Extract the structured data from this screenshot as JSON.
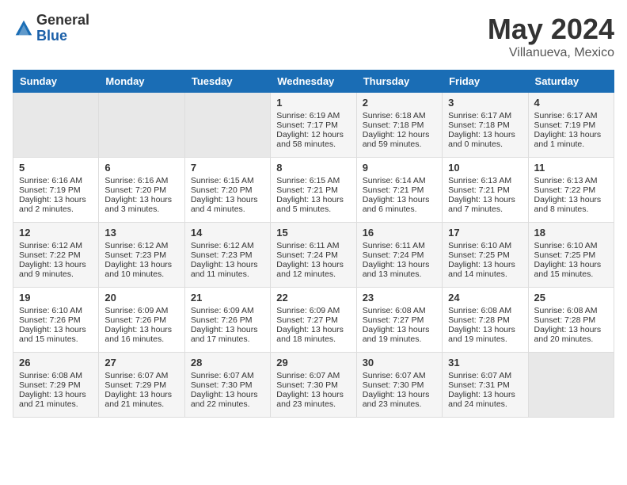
{
  "header": {
    "logo_general": "General",
    "logo_blue": "Blue",
    "month_year": "May 2024",
    "location": "Villanueva, Mexico"
  },
  "days_of_week": [
    "Sunday",
    "Monday",
    "Tuesday",
    "Wednesday",
    "Thursday",
    "Friday",
    "Saturday"
  ],
  "weeks": [
    [
      {
        "day": "",
        "sunrise": "",
        "sunset": "",
        "daylight": "",
        "empty": true
      },
      {
        "day": "",
        "sunrise": "",
        "sunset": "",
        "daylight": "",
        "empty": true
      },
      {
        "day": "",
        "sunrise": "",
        "sunset": "",
        "daylight": "",
        "empty": true
      },
      {
        "day": "1",
        "sunrise": "Sunrise: 6:19 AM",
        "sunset": "Sunset: 7:17 PM",
        "daylight": "Daylight: 12 hours and 58 minutes."
      },
      {
        "day": "2",
        "sunrise": "Sunrise: 6:18 AM",
        "sunset": "Sunset: 7:18 PM",
        "daylight": "Daylight: 12 hours and 59 minutes."
      },
      {
        "day": "3",
        "sunrise": "Sunrise: 6:17 AM",
        "sunset": "Sunset: 7:18 PM",
        "daylight": "Daylight: 13 hours and 0 minutes."
      },
      {
        "day": "4",
        "sunrise": "Sunrise: 6:17 AM",
        "sunset": "Sunset: 7:19 PM",
        "daylight": "Daylight: 13 hours and 1 minute."
      }
    ],
    [
      {
        "day": "5",
        "sunrise": "Sunrise: 6:16 AM",
        "sunset": "Sunset: 7:19 PM",
        "daylight": "Daylight: 13 hours and 2 minutes."
      },
      {
        "day": "6",
        "sunrise": "Sunrise: 6:16 AM",
        "sunset": "Sunset: 7:20 PM",
        "daylight": "Daylight: 13 hours and 3 minutes."
      },
      {
        "day": "7",
        "sunrise": "Sunrise: 6:15 AM",
        "sunset": "Sunset: 7:20 PM",
        "daylight": "Daylight: 13 hours and 4 minutes."
      },
      {
        "day": "8",
        "sunrise": "Sunrise: 6:15 AM",
        "sunset": "Sunset: 7:21 PM",
        "daylight": "Daylight: 13 hours and 5 minutes."
      },
      {
        "day": "9",
        "sunrise": "Sunrise: 6:14 AM",
        "sunset": "Sunset: 7:21 PM",
        "daylight": "Daylight: 13 hours and 6 minutes."
      },
      {
        "day": "10",
        "sunrise": "Sunrise: 6:13 AM",
        "sunset": "Sunset: 7:21 PM",
        "daylight": "Daylight: 13 hours and 7 minutes."
      },
      {
        "day": "11",
        "sunrise": "Sunrise: 6:13 AM",
        "sunset": "Sunset: 7:22 PM",
        "daylight": "Daylight: 13 hours and 8 minutes."
      }
    ],
    [
      {
        "day": "12",
        "sunrise": "Sunrise: 6:12 AM",
        "sunset": "Sunset: 7:22 PM",
        "daylight": "Daylight: 13 hours and 9 minutes."
      },
      {
        "day": "13",
        "sunrise": "Sunrise: 6:12 AM",
        "sunset": "Sunset: 7:23 PM",
        "daylight": "Daylight: 13 hours and 10 minutes."
      },
      {
        "day": "14",
        "sunrise": "Sunrise: 6:12 AM",
        "sunset": "Sunset: 7:23 PM",
        "daylight": "Daylight: 13 hours and 11 minutes."
      },
      {
        "day": "15",
        "sunrise": "Sunrise: 6:11 AM",
        "sunset": "Sunset: 7:24 PM",
        "daylight": "Daylight: 13 hours and 12 minutes."
      },
      {
        "day": "16",
        "sunrise": "Sunrise: 6:11 AM",
        "sunset": "Sunset: 7:24 PM",
        "daylight": "Daylight: 13 hours and 13 minutes."
      },
      {
        "day": "17",
        "sunrise": "Sunrise: 6:10 AM",
        "sunset": "Sunset: 7:25 PM",
        "daylight": "Daylight: 13 hours and 14 minutes."
      },
      {
        "day": "18",
        "sunrise": "Sunrise: 6:10 AM",
        "sunset": "Sunset: 7:25 PM",
        "daylight": "Daylight: 13 hours and 15 minutes."
      }
    ],
    [
      {
        "day": "19",
        "sunrise": "Sunrise: 6:10 AM",
        "sunset": "Sunset: 7:26 PM",
        "daylight": "Daylight: 13 hours and 15 minutes."
      },
      {
        "day": "20",
        "sunrise": "Sunrise: 6:09 AM",
        "sunset": "Sunset: 7:26 PM",
        "daylight": "Daylight: 13 hours and 16 minutes."
      },
      {
        "day": "21",
        "sunrise": "Sunrise: 6:09 AM",
        "sunset": "Sunset: 7:26 PM",
        "daylight": "Daylight: 13 hours and 17 minutes."
      },
      {
        "day": "22",
        "sunrise": "Sunrise: 6:09 AM",
        "sunset": "Sunset: 7:27 PM",
        "daylight": "Daylight: 13 hours and 18 minutes."
      },
      {
        "day": "23",
        "sunrise": "Sunrise: 6:08 AM",
        "sunset": "Sunset: 7:27 PM",
        "daylight": "Daylight: 13 hours and 19 minutes."
      },
      {
        "day": "24",
        "sunrise": "Sunrise: 6:08 AM",
        "sunset": "Sunset: 7:28 PM",
        "daylight": "Daylight: 13 hours and 19 minutes."
      },
      {
        "day": "25",
        "sunrise": "Sunrise: 6:08 AM",
        "sunset": "Sunset: 7:28 PM",
        "daylight": "Daylight: 13 hours and 20 minutes."
      }
    ],
    [
      {
        "day": "26",
        "sunrise": "Sunrise: 6:08 AM",
        "sunset": "Sunset: 7:29 PM",
        "daylight": "Daylight: 13 hours and 21 minutes."
      },
      {
        "day": "27",
        "sunrise": "Sunrise: 6:07 AM",
        "sunset": "Sunset: 7:29 PM",
        "daylight": "Daylight: 13 hours and 21 minutes."
      },
      {
        "day": "28",
        "sunrise": "Sunrise: 6:07 AM",
        "sunset": "Sunset: 7:30 PM",
        "daylight": "Daylight: 13 hours and 22 minutes."
      },
      {
        "day": "29",
        "sunrise": "Sunrise: 6:07 AM",
        "sunset": "Sunset: 7:30 PM",
        "daylight": "Daylight: 13 hours and 23 minutes."
      },
      {
        "day": "30",
        "sunrise": "Sunrise: 6:07 AM",
        "sunset": "Sunset: 7:30 PM",
        "daylight": "Daylight: 13 hours and 23 minutes."
      },
      {
        "day": "31",
        "sunrise": "Sunrise: 6:07 AM",
        "sunset": "Sunset: 7:31 PM",
        "daylight": "Daylight: 13 hours and 24 minutes."
      },
      {
        "day": "",
        "sunrise": "",
        "sunset": "",
        "daylight": "",
        "empty": true
      }
    ]
  ]
}
